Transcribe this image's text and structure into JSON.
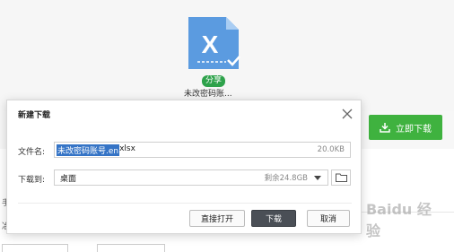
{
  "background": {
    "file_tile": {
      "icon": "excel-file-icon",
      "letter": "X",
      "share_badge": "分享",
      "file_name": "未改密码账..."
    },
    "download_now_button": "立即下载",
    "side_chars": [
      "手",
      "冶"
    ],
    "watermark_text": "Baidu 经验"
  },
  "dialog": {
    "title": "新建下载",
    "filename_label": "文件名:",
    "filename_selected": "未改密码账号.en",
    "filename_rest": "xlsx",
    "filename_size": "20.0KB",
    "saveto_label": "下载到:",
    "saveto_value": "桌面",
    "saveto_free": "剩余24.8GB",
    "buttons": {
      "open_directly": "直接打开",
      "download": "下载",
      "cancel": "取消"
    }
  },
  "colors": {
    "accent_green": "#3fb23f",
    "excel_blue": "#4a90d9",
    "selection_blue": "#3574c6",
    "primary_button": "#4a4f56"
  }
}
